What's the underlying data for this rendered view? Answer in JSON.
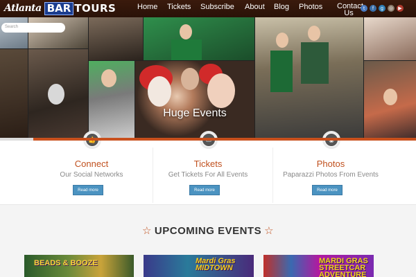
{
  "header": {
    "logo": {
      "part1": "Atlanta",
      "part2": "BAR",
      "part3": "TOURS"
    },
    "nav": [
      "Home",
      "Tickets",
      "Subscribe",
      "About",
      "Blog",
      "Photos",
      "Contact Us"
    ],
    "social_icons": [
      "twitter-icon",
      "facebook-icon",
      "google-plus-icon",
      "instagram-icon",
      "youtube-icon"
    ]
  },
  "hero": {
    "search_placeholder": "Search",
    "caption": "Huge Events"
  },
  "features": [
    {
      "title": "Connect",
      "subtitle": "Our Social Networks",
      "button": "Read more",
      "icon": "thumbs-up-icon"
    },
    {
      "title": "Tickets",
      "subtitle": "Get Tickets For All Events",
      "button": "Read more",
      "icon": "credit-card-icon"
    },
    {
      "title": "Photos",
      "subtitle": "Paparazzi Photos From Events",
      "button": "Read more",
      "icon": "camera-icon"
    }
  ],
  "upcoming": {
    "title": "UPCOMING EVENTS",
    "events": [
      {
        "text": "BEADS & BOOZE"
      },
      {
        "text": "Mardi Gras MIDTOWN"
      },
      {
        "text": "MARDI GRAS STREETCAR ADVENTURE"
      }
    ]
  },
  "colors": {
    "accent": "#c0501e",
    "button": "#4b93c1",
    "header_bg": "#3a1a0c"
  }
}
